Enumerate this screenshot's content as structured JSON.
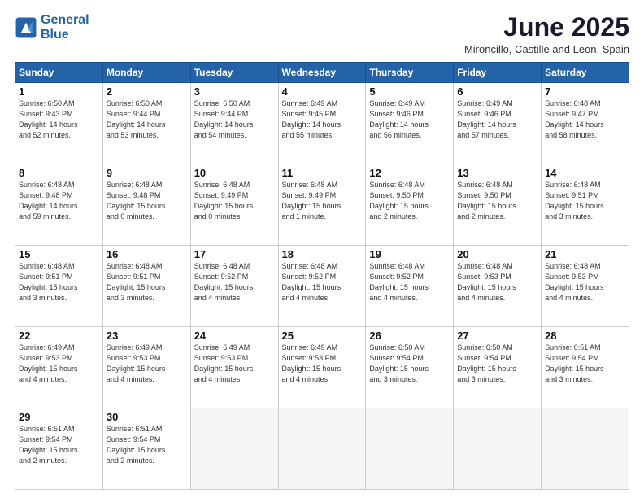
{
  "logo": {
    "line1": "General",
    "line2": "Blue"
  },
  "title": "June 2025",
  "location": "Mironcillo, Castille and Leon, Spain",
  "days_of_week": [
    "Sunday",
    "Monday",
    "Tuesday",
    "Wednesday",
    "Thursday",
    "Friday",
    "Saturday"
  ],
  "weeks": [
    [
      {
        "day": "1",
        "info": "Sunrise: 6:50 AM\nSunset: 9:43 PM\nDaylight: 14 hours\nand 52 minutes."
      },
      {
        "day": "2",
        "info": "Sunrise: 6:50 AM\nSunset: 9:44 PM\nDaylight: 14 hours\nand 53 minutes."
      },
      {
        "day": "3",
        "info": "Sunrise: 6:50 AM\nSunset: 9:44 PM\nDaylight: 14 hours\nand 54 minutes."
      },
      {
        "day": "4",
        "info": "Sunrise: 6:49 AM\nSunset: 9:45 PM\nDaylight: 14 hours\nand 55 minutes."
      },
      {
        "day": "5",
        "info": "Sunrise: 6:49 AM\nSunset: 9:46 PM\nDaylight: 14 hours\nand 56 minutes."
      },
      {
        "day": "6",
        "info": "Sunrise: 6:49 AM\nSunset: 9:46 PM\nDaylight: 14 hours\nand 57 minutes."
      },
      {
        "day": "7",
        "info": "Sunrise: 6:48 AM\nSunset: 9:47 PM\nDaylight: 14 hours\nand 58 minutes."
      }
    ],
    [
      {
        "day": "8",
        "info": "Sunrise: 6:48 AM\nSunset: 9:48 PM\nDaylight: 14 hours\nand 59 minutes."
      },
      {
        "day": "9",
        "info": "Sunrise: 6:48 AM\nSunset: 9:48 PM\nDaylight: 15 hours\nand 0 minutes."
      },
      {
        "day": "10",
        "info": "Sunrise: 6:48 AM\nSunset: 9:49 PM\nDaylight: 15 hours\nand 0 minutes."
      },
      {
        "day": "11",
        "info": "Sunrise: 6:48 AM\nSunset: 9:49 PM\nDaylight: 15 hours\nand 1 minute."
      },
      {
        "day": "12",
        "info": "Sunrise: 6:48 AM\nSunset: 9:50 PM\nDaylight: 15 hours\nand 2 minutes."
      },
      {
        "day": "13",
        "info": "Sunrise: 6:48 AM\nSunset: 9:50 PM\nDaylight: 15 hours\nand 2 minutes."
      },
      {
        "day": "14",
        "info": "Sunrise: 6:48 AM\nSunset: 9:51 PM\nDaylight: 15 hours\nand 3 minutes."
      }
    ],
    [
      {
        "day": "15",
        "info": "Sunrise: 6:48 AM\nSunset: 9:51 PM\nDaylight: 15 hours\nand 3 minutes."
      },
      {
        "day": "16",
        "info": "Sunrise: 6:48 AM\nSunset: 9:51 PM\nDaylight: 15 hours\nand 3 minutes."
      },
      {
        "day": "17",
        "info": "Sunrise: 6:48 AM\nSunset: 9:52 PM\nDaylight: 15 hours\nand 4 minutes."
      },
      {
        "day": "18",
        "info": "Sunrise: 6:48 AM\nSunset: 9:52 PM\nDaylight: 15 hours\nand 4 minutes."
      },
      {
        "day": "19",
        "info": "Sunrise: 6:48 AM\nSunset: 9:52 PM\nDaylight: 15 hours\nand 4 minutes."
      },
      {
        "day": "20",
        "info": "Sunrise: 6:48 AM\nSunset: 9:53 PM\nDaylight: 15 hours\nand 4 minutes."
      },
      {
        "day": "21",
        "info": "Sunrise: 6:48 AM\nSunset: 9:53 PM\nDaylight: 15 hours\nand 4 minutes."
      }
    ],
    [
      {
        "day": "22",
        "info": "Sunrise: 6:49 AM\nSunset: 9:53 PM\nDaylight: 15 hours\nand 4 minutes."
      },
      {
        "day": "23",
        "info": "Sunrise: 6:49 AM\nSunset: 9:53 PM\nDaylight: 15 hours\nand 4 minutes."
      },
      {
        "day": "24",
        "info": "Sunrise: 6:49 AM\nSunset: 9:53 PM\nDaylight: 15 hours\nand 4 minutes."
      },
      {
        "day": "25",
        "info": "Sunrise: 6:49 AM\nSunset: 9:53 PM\nDaylight: 15 hours\nand 4 minutes."
      },
      {
        "day": "26",
        "info": "Sunrise: 6:50 AM\nSunset: 9:54 PM\nDaylight: 15 hours\nand 3 minutes."
      },
      {
        "day": "27",
        "info": "Sunrise: 6:50 AM\nSunset: 9:54 PM\nDaylight: 15 hours\nand 3 minutes."
      },
      {
        "day": "28",
        "info": "Sunrise: 6:51 AM\nSunset: 9:54 PM\nDaylight: 15 hours\nand 3 minutes."
      }
    ],
    [
      {
        "day": "29",
        "info": "Sunrise: 6:51 AM\nSunset: 9:54 PM\nDaylight: 15 hours\nand 2 minutes."
      },
      {
        "day": "30",
        "info": "Sunrise: 6:51 AM\nSunset: 9:54 PM\nDaylight: 15 hours\nand 2 minutes."
      },
      {
        "day": "",
        "info": ""
      },
      {
        "day": "",
        "info": ""
      },
      {
        "day": "",
        "info": ""
      },
      {
        "day": "",
        "info": ""
      },
      {
        "day": "",
        "info": ""
      }
    ]
  ]
}
